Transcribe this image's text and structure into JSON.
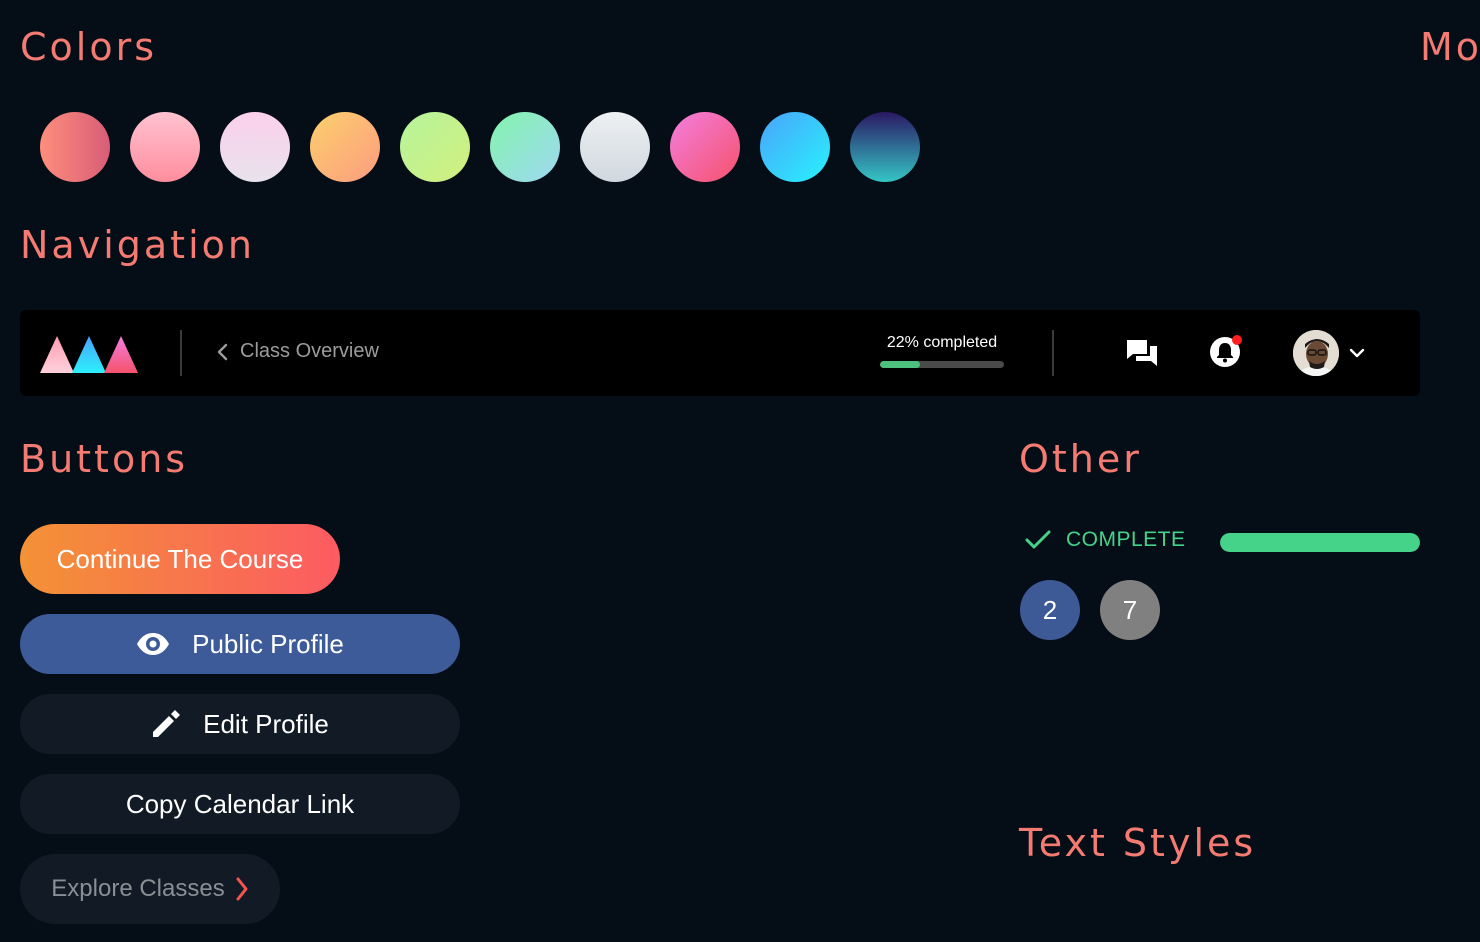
{
  "sections": {
    "colors": "Colors",
    "more": "Mo",
    "navigation": "Navigation",
    "buttons": "Buttons",
    "other": "Other",
    "text_styles": "Text Styles"
  },
  "theme": {
    "background": "#050d17",
    "heading_color": "#f47b72",
    "success": "#45d38a"
  },
  "swatches": [
    {
      "from": "#ff8e7c",
      "to": "#d75d78",
      "dir": "90deg"
    },
    {
      "from": "#ffc2d0",
      "to": "#ff8e9e",
      "dir": "180deg"
    },
    {
      "from": "#fbd0ec",
      "to": "#e8e2ec",
      "dir": "180deg"
    },
    {
      "from": "#fbd06c",
      "to": "#fd9c80",
      "dir": "135deg"
    },
    {
      "from": "#b6f59c",
      "to": "#d2ef7e",
      "dir": "135deg"
    },
    {
      "from": "#84f4ac",
      "to": "#9ed8f2",
      "dir": "135deg"
    },
    {
      "from": "#eef0f2",
      "to": "#d0d8df",
      "dir": "180deg"
    },
    {
      "from": "#f47ee0",
      "to": "#f5526b",
      "dir": "135deg"
    },
    {
      "from": "#4aa3fb",
      "to": "#28f2fc",
      "dir": "135deg"
    },
    {
      "from": "#2a1863",
      "to": "#35c6c6",
      "dir": "180deg"
    }
  ],
  "navbar": {
    "logo_icon": "triangles-logo-icon",
    "back_icon": "chevron-left-icon",
    "back_label": "Class Overview",
    "progress_label": "22% completed",
    "progress_fraction": 0.32,
    "chat_icon": "chat-bubbles-icon",
    "bell_icon": "bell-icon",
    "avatar_icon": "user-avatar",
    "menu_icon": "chevron-down-icon"
  },
  "buttons": {
    "continue": "Continue The Course",
    "public_profile": "Public Profile",
    "public_icon": "eye-icon",
    "edit_profile": "Edit Profile",
    "edit_icon": "pencil-icon",
    "copy_calendar": "Copy Calendar Link",
    "explore": "Explore Classes",
    "explore_icon": "chevron-right-icon"
  },
  "other": {
    "complete_label": "COMPLETE",
    "complete_icon": "checkmark-icon",
    "complete_fraction": 1.0,
    "badges": [
      "2",
      "7"
    ]
  }
}
